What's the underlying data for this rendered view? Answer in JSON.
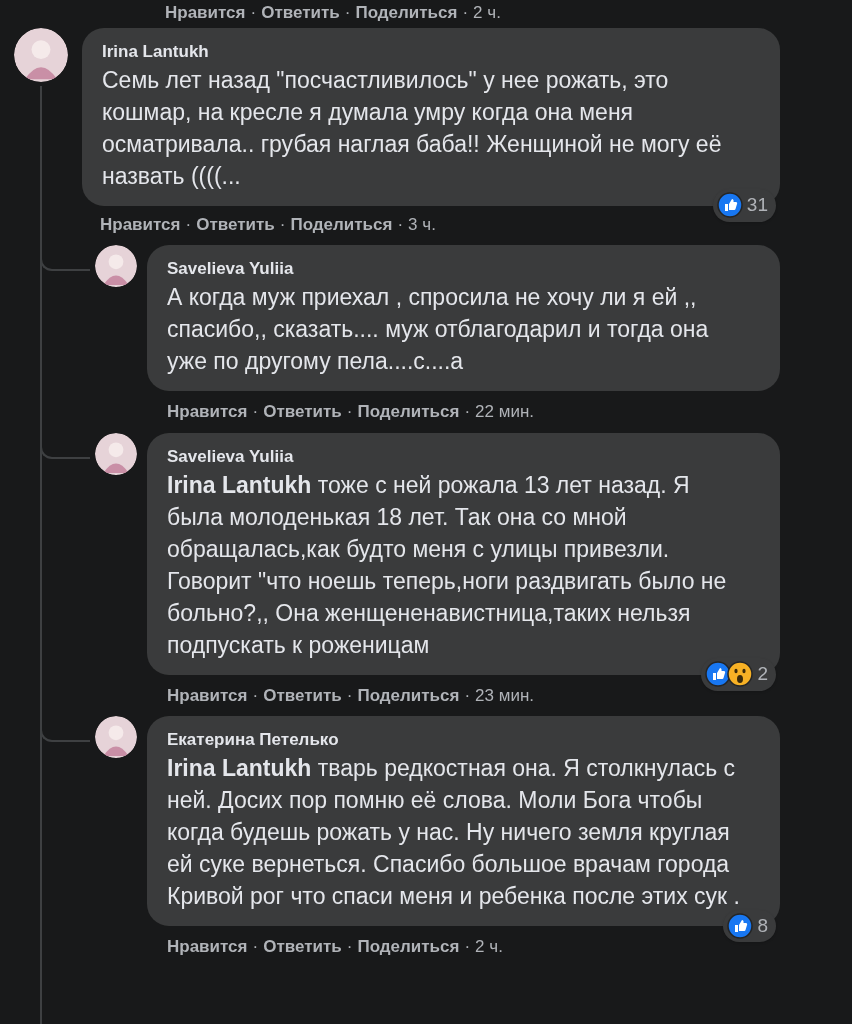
{
  "previous_actions": [
    {
      "kind": "link",
      "text": "Нравится"
    },
    {
      "kind": "sep",
      "text": "·"
    },
    {
      "kind": "link",
      "text": "Ответить"
    },
    {
      "kind": "sep",
      "text": "·"
    },
    {
      "kind": "link",
      "text": "Поделиться"
    },
    {
      "kind": "sep",
      "text": "·"
    },
    {
      "kind": "time",
      "text": "2 ч."
    }
  ],
  "comment": {
    "author": "Irina Lantukh",
    "text": "Семь лет назад \"посчастливилось\" у нее рожать, это кошмар, на кресле я думала умру когда она меня осматривала.. грубая наглая баба!! Женщиной не могу её назвать ((((...",
    "reactions": {
      "icons": [
        {
          "kind": "like"
        }
      ],
      "count": "31"
    },
    "actions": [
      {
        "kind": "link",
        "text": "Нравится"
      },
      {
        "kind": "sep",
        "text": "·"
      },
      {
        "kind": "link",
        "text": "Ответить"
      },
      {
        "kind": "sep",
        "text": "·"
      },
      {
        "kind": "link",
        "text": "Поделиться"
      },
      {
        "kind": "sep",
        "text": "·"
      },
      {
        "kind": "time",
        "text": "3 ч."
      }
    ]
  },
  "replies": [
    {
      "author": "Savelieva Yuliia",
      "text": "А когда муж приехал , спросила не хочу ли я ей ,, спасибо,, сказать.... муж отблагодарил и тогда она уже по другому пела....с....а",
      "actions": [
        {
          "kind": "link",
          "text": "Нравится"
        },
        {
          "kind": "sep",
          "text": "·"
        },
        {
          "kind": "link",
          "text": "Ответить"
        },
        {
          "kind": "sep",
          "text": "·"
        },
        {
          "kind": "link",
          "text": "Поделиться"
        },
        {
          "kind": "sep",
          "text": "·"
        },
        {
          "kind": "time",
          "text": "22 мин."
        }
      ]
    },
    {
      "author": "Savelieva Yuliia",
      "text": "**Irina Lantukh** тоже с ней рожала 13 лет назад. Я была молоденькая 18 лет. Так она со мной обращалась,как будто меня с улицы привезли. Говорит \"что ноешь теперь,ноги раздвигать было не больно?,, Она женщененавистница,таких нельзя подпускать к роженицам",
      "reactions": {
        "icons": [
          {
            "kind": "like"
          },
          {
            "kind": "wow"
          }
        ],
        "count": "2"
      },
      "actions": [
        {
          "kind": "link",
          "text": "Нравится"
        },
        {
          "kind": "sep",
          "text": "·"
        },
        {
          "kind": "link",
          "text": "Ответить"
        },
        {
          "kind": "sep",
          "text": "·"
        },
        {
          "kind": "link",
          "text": "Поделиться"
        },
        {
          "kind": "sep",
          "text": "·"
        },
        {
          "kind": "time",
          "text": "23 мин."
        }
      ]
    },
    {
      "author": "Екатерина Петелько",
      "text": "**Irina Lantukh** тварь редкостная она. Я столкнулась с ней. Досих пор помню её слова. Моли Бога чтобы когда будешь рожать у нас. Ну ничего земля круглая ей суке вернеться. Спасибо большое врачам города Кривой рог что спаси меня и ребенка после этих сук .",
      "reactions": {
        "icons": [
          {
            "kind": "like"
          }
        ],
        "count": "8"
      },
      "actions": [
        {
          "kind": "link",
          "text": "Нравится"
        },
        {
          "kind": "sep",
          "text": "·"
        },
        {
          "kind": "link",
          "text": "Ответить"
        },
        {
          "kind": "sep",
          "text": "·"
        },
        {
          "kind": "link",
          "text": "Поделиться"
        },
        {
          "kind": "sep",
          "text": "·"
        },
        {
          "kind": "time",
          "text": "2 ч."
        }
      ]
    }
  ]
}
